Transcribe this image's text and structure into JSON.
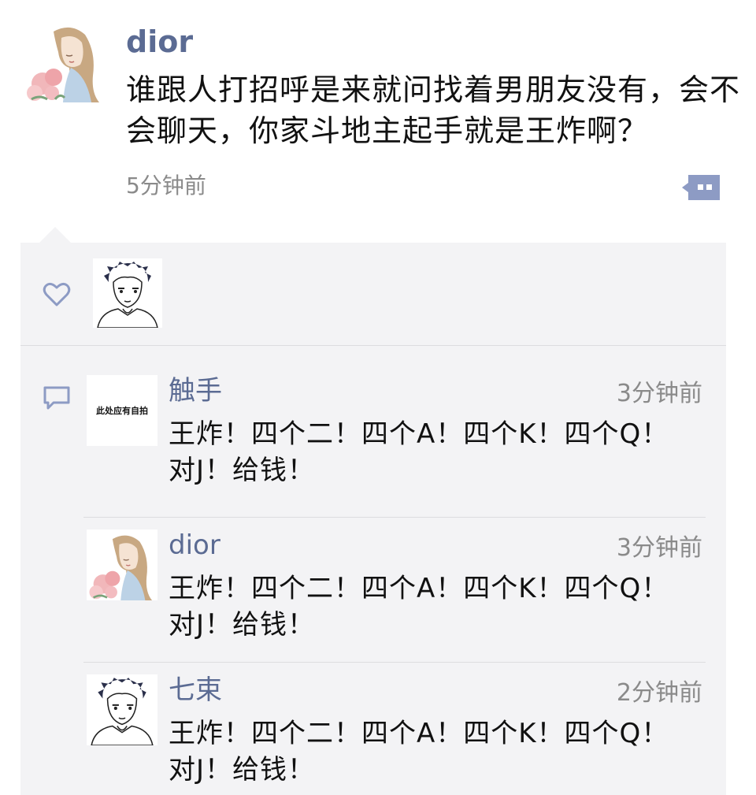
{
  "post": {
    "author": "dior",
    "text": "谁跟人打招呼是来就问找着男朋友没有，会不会聊天，你家斗地主起手就是王炸啊？",
    "time": "5分钟前",
    "avatar_icon": "girl-with-flowers-avatar"
  },
  "likes": {
    "icon": "heart-icon",
    "users": [
      {
        "avatar_icon": "boy-sketch-avatar"
      }
    ]
  },
  "comments": {
    "icon": "comment-icon",
    "items": [
      {
        "name": "触手",
        "time": "3分钟前",
        "text": "王炸！四个二！四个A！四个K！四个Q！对J！给钱！",
        "avatar_text": "此处应有自拍"
      },
      {
        "name": "dior",
        "time": "3分钟前",
        "text": "王炸！四个二！四个A！四个K！四个Q！对J！给钱！",
        "avatar_icon": "girl-with-flowers-avatar"
      },
      {
        "name": "七束",
        "time": "2分钟前",
        "text": "王炸！四个二！四个A！四个K！四个Q！对J！给钱！",
        "avatar_icon": "boy-sketch-avatar"
      }
    ]
  },
  "colors": {
    "name": "#5b6b93",
    "meta": "#8a8a8a",
    "panel": "#f3f3f5",
    "divider": "#dcdcdf"
  }
}
